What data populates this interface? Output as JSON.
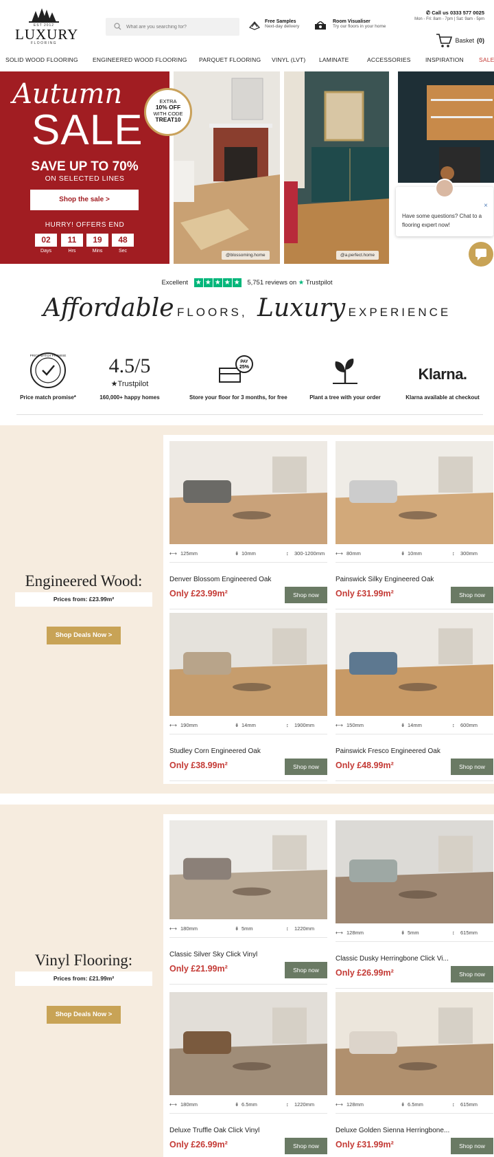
{
  "header": {
    "logo": {
      "est": "EST 2012",
      "name": "LUXURY",
      "sub": "FLOORING"
    },
    "search": {
      "placeholder": "What are you searching for?"
    },
    "samples": {
      "title": "Free Samples",
      "sub": "Next-day delivery"
    },
    "visualiser": {
      "title": "Room Visualiser",
      "sub": "Try our floors in your home"
    },
    "call": {
      "title": "Call us 0333 577 0025",
      "hours": "Mon - Fri: 8am - 7pm | Sat: 9am - 5pm"
    },
    "basket": {
      "label": "Basket",
      "count": "(0)"
    }
  },
  "nav": [
    "SOLID WOOD FLOORING",
    "ENGINEERED WOOD FLOORING",
    "PARQUET FLOORING",
    "VINYL (LVT)",
    "LAMINATE",
    "ACCESSORIES",
    "INSPIRATION",
    "SALE"
  ],
  "hero": {
    "script": "Autumn",
    "title": "SALE",
    "save": "SAVE UP TO 70%",
    "selected": "ON SELECTED LINES",
    "cta": "Shop the sale >",
    "hurry": "HURRY! OFFERS END",
    "countdown": [
      {
        "n": "02",
        "l": "Days"
      },
      {
        "n": "11",
        "l": "Hrs"
      },
      {
        "n": "19",
        "l": "Mins"
      },
      {
        "n": "48",
        "l": "Sec"
      }
    ],
    "badge": {
      "l1": "EXTRA",
      "l2": "10% OFF",
      "l3": "WITH CODE",
      "l4": "TREAT10"
    },
    "credits": [
      "@blossoming.home",
      "@a.perfect.home"
    ]
  },
  "chat": {
    "message": "Have some questions? Chat to a flooring expert now!",
    "close": "×"
  },
  "trustpilot": {
    "rating": "Excellent",
    "reviews": "5,751 reviews on",
    "brand": "Trustpilot"
  },
  "tagline": {
    "w1": "Affordable",
    "w2": "FLOORS,",
    "w3": "Luxury",
    "w4": "EXPERIENCE"
  },
  "usps": [
    {
      "caption": "Price match promise*",
      "badge_text": "PRICE MATCH PROMISE"
    },
    {
      "caption": "160,000+ happy homes",
      "big": "4.5/5",
      "sub": "Trustpilot"
    },
    {
      "caption": "Store your floor for 3 months, for free",
      "bubble1": "PAY",
      "bubble2": "25%"
    },
    {
      "caption": "Plant a tree with your order"
    },
    {
      "caption": "Klarna available at checkout",
      "logo": "Klarna."
    }
  ],
  "engineered": {
    "title": "Engineered Wood:",
    "prices": "Prices from: £23.99m²",
    "cta": "Shop Deals Now >",
    "products": [
      {
        "w": "125mm",
        "t": "10mm",
        "l": "300-1200mm",
        "name": "Denver Blossom Engineered Oak",
        "price": "Only £23.99m²",
        "btn": "Shop now"
      },
      {
        "w": "80mm",
        "t": "10mm",
        "l": "300mm",
        "name": "Painswick Silky Engineered Oak",
        "price": "Only £31.99m²",
        "btn": "Shop now"
      },
      {
        "w": "190mm",
        "t": "14mm",
        "l": "1900mm",
        "name": "Studley Corn Engineered Oak",
        "price": "Only £38.99m²",
        "btn": "Shop now"
      },
      {
        "w": "150mm",
        "t": "14mm",
        "l": "600mm",
        "name": "Painswick Fresco Engineered Oak",
        "price": "Only £48.99m²",
        "btn": "Shop now"
      }
    ]
  },
  "vinyl": {
    "title": "Vinyl Flooring:",
    "prices": "Prices from: £21.99m²",
    "cta": "Shop Deals Now >",
    "products": [
      {
        "w": "180mm",
        "t": "5mm",
        "l": "1220mm",
        "name": "Classic Silver Sky Click Vinyl",
        "price": "Only £21.99m²",
        "btn": "Shop now"
      },
      {
        "w": "128mm",
        "t": "5mm",
        "l": "615mm",
        "name": "Classic Dusky Herringbone Click Vi...",
        "price": "Only £26.99m²",
        "btn": "Shop now"
      },
      {
        "w": "180mm",
        "t": "6.5mm",
        "l": "1220mm",
        "name": "Deluxe Truffle Oak Click Vinyl",
        "price": "Only £26.99m²",
        "btn": "Shop now"
      },
      {
        "w": "128mm",
        "t": "6.5mm",
        "l": "615mm",
        "name": "Deluxe Golden Sienna Herringbone...",
        "price": "Only £31.99m²",
        "btn": "Shop now"
      }
    ]
  },
  "colors": {
    "brand_red": "#a11d22",
    "gold": "#c8a356",
    "sage": "#6a7a64",
    "price_red": "#c43a35",
    "cream": "#f6ecdf",
    "trustpilot_green": "#00b67a"
  }
}
